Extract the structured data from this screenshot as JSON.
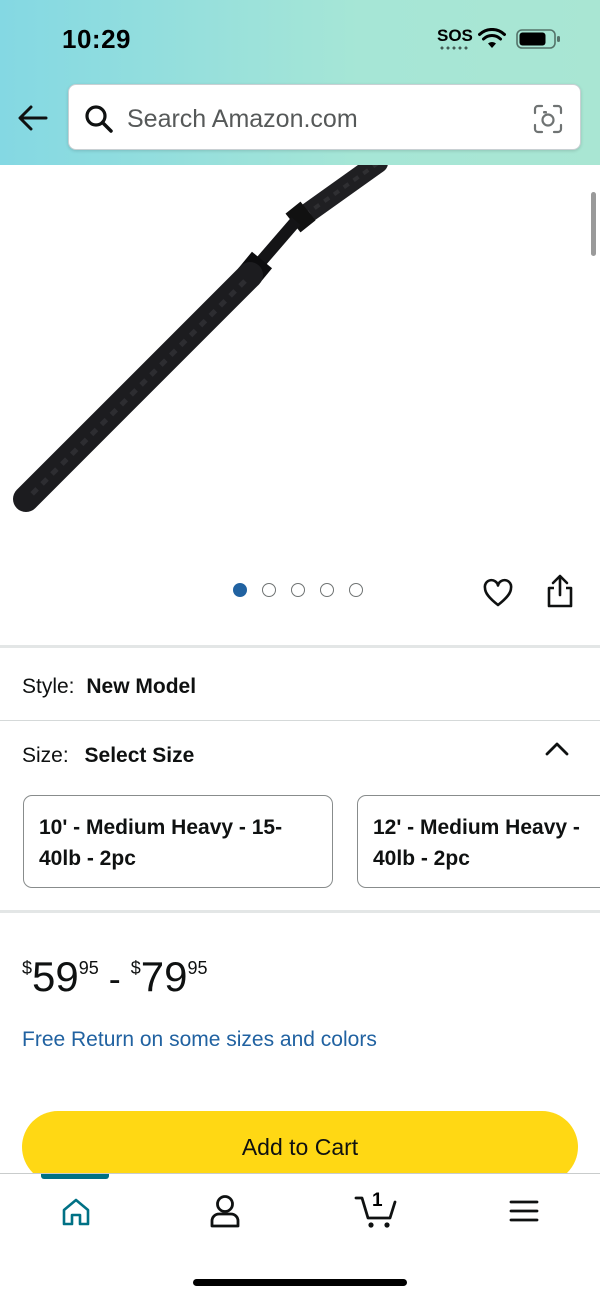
{
  "status_bar": {
    "time": "10:29",
    "sos": "SOS"
  },
  "search": {
    "placeholder": "Search Amazon.com"
  },
  "gallery": {
    "image_count": 5,
    "active_index": 0
  },
  "style": {
    "label": "Style:",
    "value": "New Model"
  },
  "size": {
    "label": "Size:",
    "value": "Select Size",
    "options": [
      "10' - Medium Heavy - 15-40lb - 2pc",
      "12' - Medium Heavy - 40lb - 2pc"
    ]
  },
  "price": {
    "low": {
      "symbol": "$",
      "whole": "59",
      "fraction": "95"
    },
    "separator": "-",
    "high": {
      "symbol": "$",
      "whole": "79",
      "fraction": "95"
    }
  },
  "free_return": "Free Return on some sizes and colors",
  "add_to_cart": "Add to Cart",
  "bottom_nav": {
    "cart_count": "1",
    "active_tab": "home"
  },
  "colors": {
    "accent_link": "#2162a1",
    "add_to_cart_bg": "#ffd814",
    "nav_active": "#007185"
  }
}
